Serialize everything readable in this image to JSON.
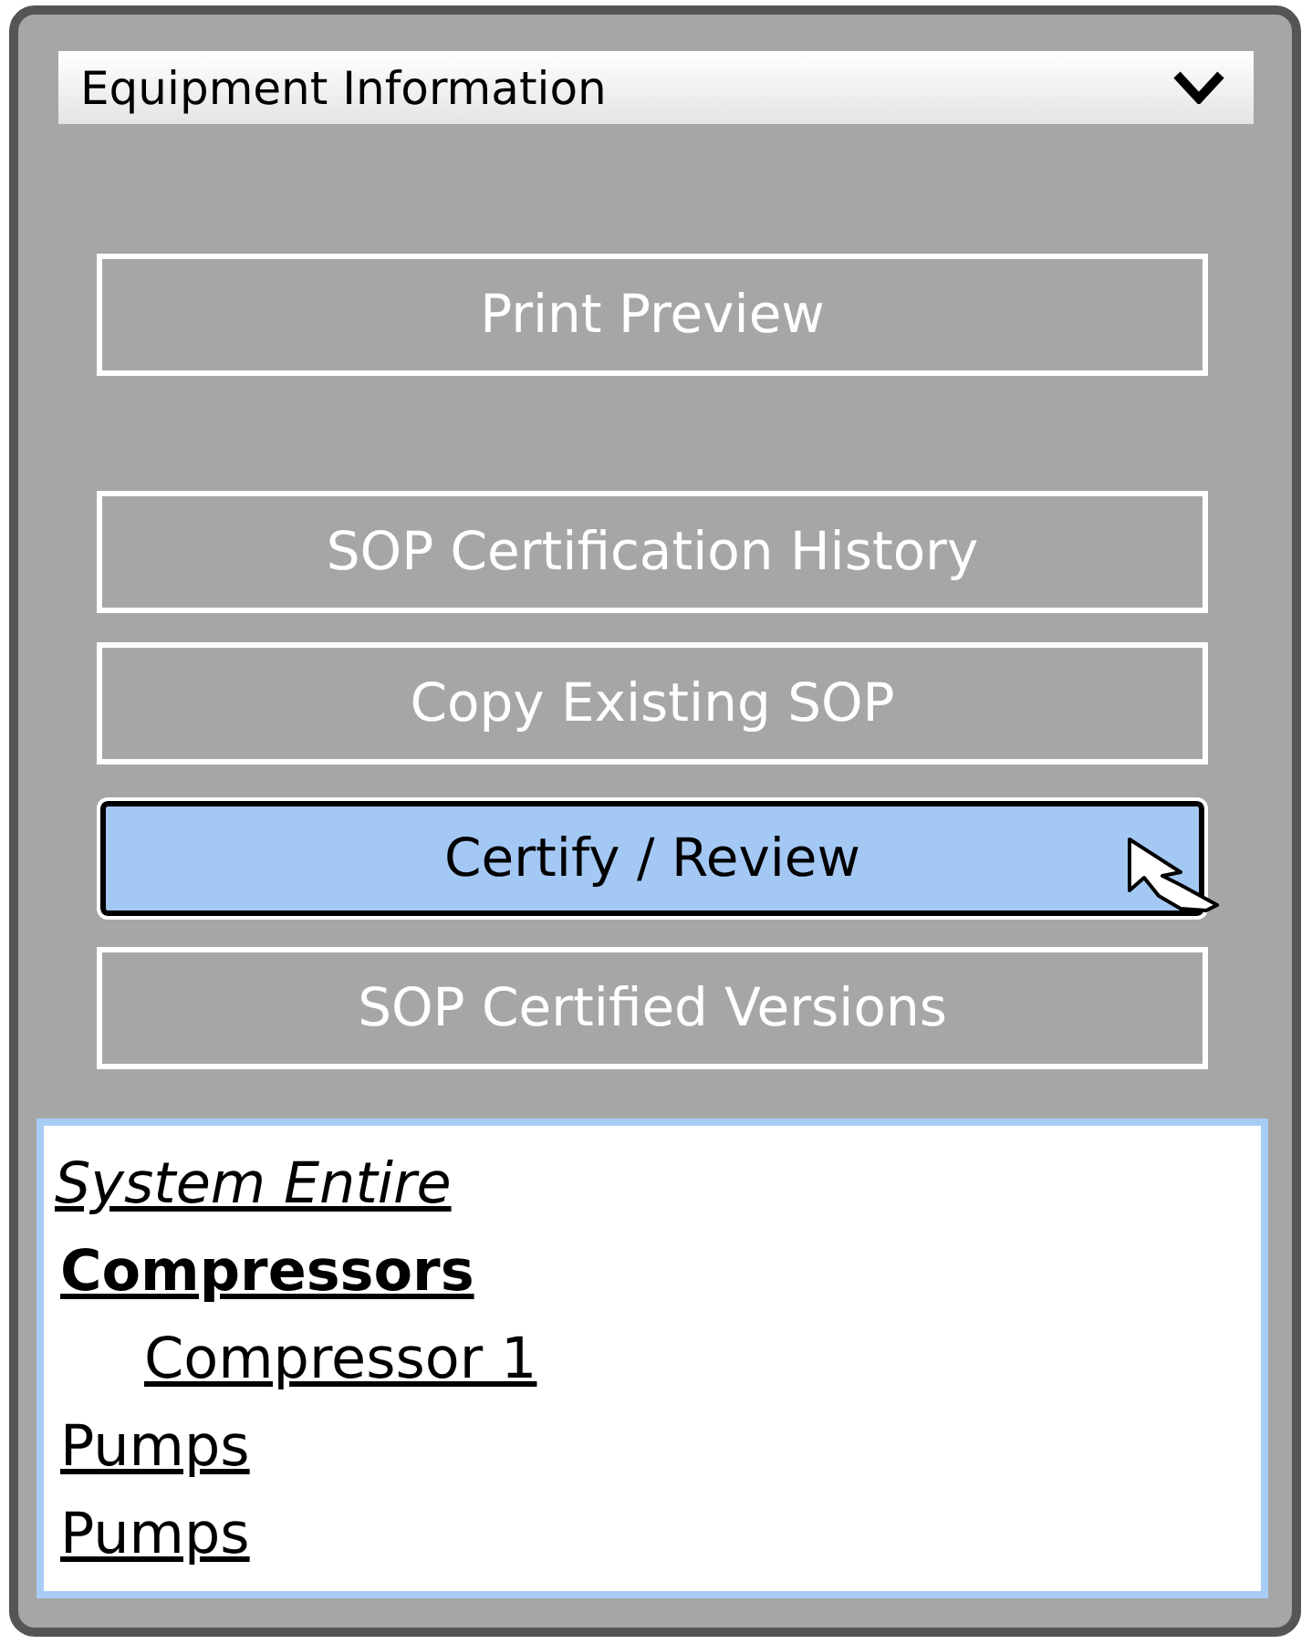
{
  "dropdown": {
    "value": "Equipment Information"
  },
  "buttons": [
    {
      "label": "Print Preview",
      "selected": false
    },
    {
      "label": "SOP Certification History",
      "selected": false
    },
    {
      "label": "Copy Existing SOP",
      "selected": false
    },
    {
      "label": "Certify / Review",
      "selected": true
    },
    {
      "label": "SOP Certified Versions",
      "selected": false
    }
  ],
  "tree": [
    {
      "label": "System Entire",
      "kind": "root"
    },
    {
      "label": "Compressors",
      "kind": "group",
      "children": [
        {
          "label": "Compressor 1",
          "kind": "leaf"
        }
      ]
    },
    {
      "label": "Pumps",
      "kind": "leaf"
    },
    {
      "label": "Pumps",
      "kind": "leaf"
    }
  ]
}
